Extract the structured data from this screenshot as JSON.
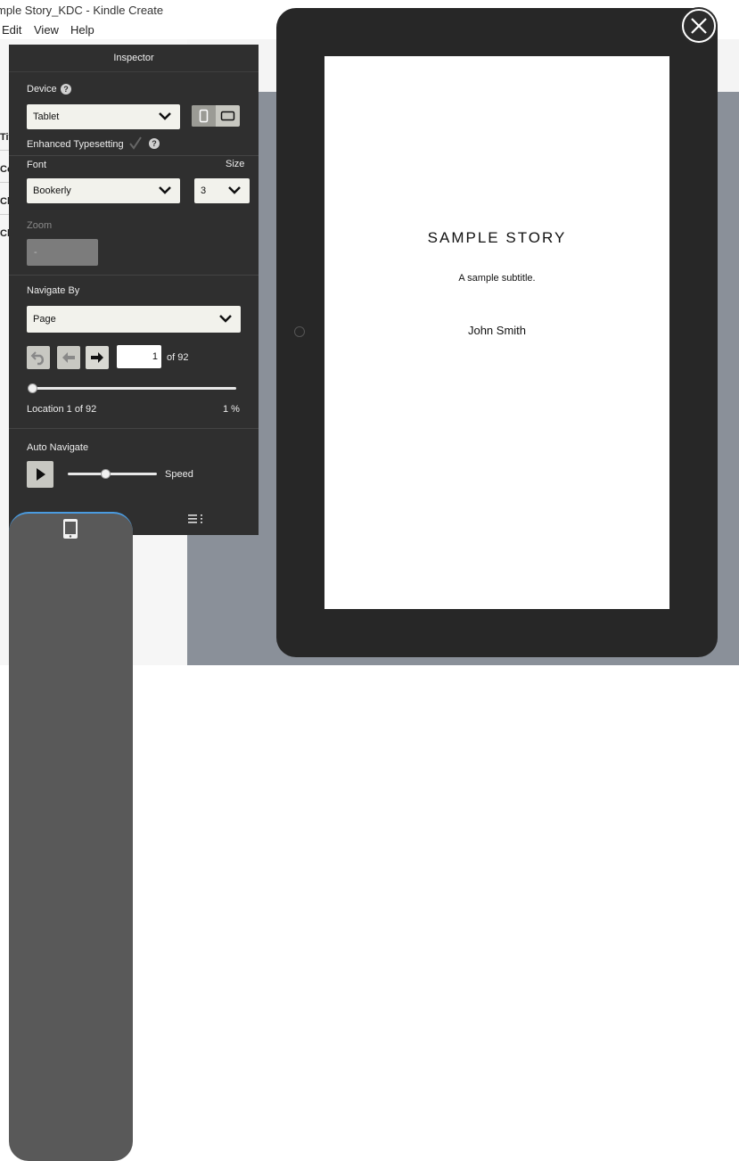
{
  "window": {
    "title": "mple Story_KDC - Kindle Create"
  },
  "menu": {
    "items": [
      "Edit",
      "View",
      "Help"
    ]
  },
  "background_panel": {
    "labels": [
      "Tit",
      "Co",
      "Ch",
      "Ch"
    ]
  },
  "inspector": {
    "title": "Inspector",
    "device": {
      "label": "Device",
      "help": "?",
      "selected": "Tablet",
      "orientation": "portrait"
    },
    "enhanced_typesetting": {
      "label": "Enhanced Typesetting",
      "help": "?",
      "checked": true
    },
    "font": {
      "label": "Font",
      "selected": "Bookerly"
    },
    "size": {
      "label": "Size",
      "selected": "3"
    },
    "zoom": {
      "label": "Zoom",
      "value": "-"
    },
    "navigate": {
      "label": "Navigate By",
      "selected": "Page",
      "page_value": "1",
      "of_label": "of 92",
      "progress_fraction": 0.01,
      "location_label": "Location 1 of 92",
      "percent_label": "1 %"
    },
    "auto_navigate": {
      "label": "Auto Navigate",
      "speed_label": "Speed",
      "speed_fraction": 0.42
    },
    "tabs": [
      {
        "name": "device-preview",
        "icon": "tablet-icon",
        "active": true
      },
      {
        "name": "table-of-contents",
        "icon": "toc-list-icon",
        "active": false
      }
    ]
  },
  "preview": {
    "book_title": "SAMPLE STORY",
    "book_subtitle": "A sample subtitle.",
    "book_author": "John Smith"
  },
  "colors": {
    "inspector_bg": "#2f2f2f",
    "device_frame": "#272727",
    "backdrop": "#8a9099",
    "active_tab_accent": "#4a9be0"
  }
}
